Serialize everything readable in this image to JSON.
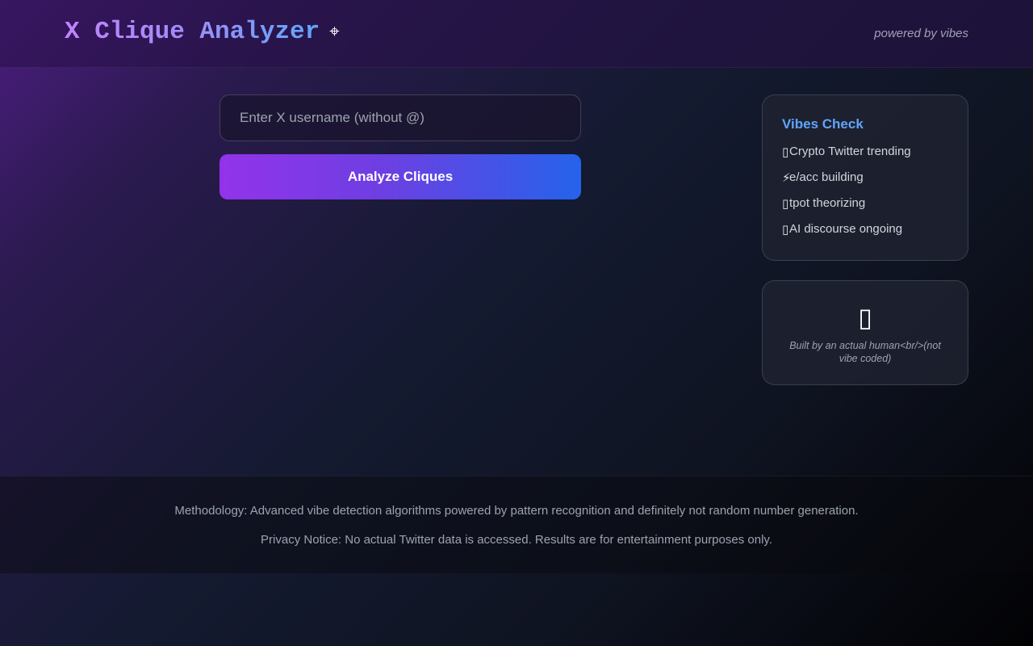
{
  "header": {
    "title": "X Clique Analyzer",
    "title_icon": "telescope-icon",
    "title_emoji": "⌖",
    "tagline": "powered by vibes"
  },
  "search": {
    "placeholder": "Enter X username (without @)",
    "value": ""
  },
  "analyze_button": {
    "label": "Analyze Cliques"
  },
  "vibes_check": {
    "title": "Vibes Check",
    "items": [
      {
        "icon": "chart-icon",
        "glyph": "▯",
        "label": "Crypto Twitter trending"
      },
      {
        "icon": "lightning-icon",
        "glyph": "⚡",
        "label": "e/acc building"
      },
      {
        "icon": "thought-icon",
        "glyph": "▯",
        "label": "tpot theorizing"
      },
      {
        "icon": "robot-icon",
        "glyph": "▯",
        "label": "AI discourse ongoing"
      }
    ]
  },
  "credit_card": {
    "icon": "human-icon",
    "glyph": "▯",
    "text": "Built by an actual human<br/>(not vibe coded)"
  },
  "footer": {
    "methodology": "Methodology: Advanced vibe detection algorithms powered by pattern recognition and definitely not random number generation.",
    "privacy": "Privacy Notice: No actual Twitter data is accessed. Results are for entertainment purposes only."
  },
  "colors": {
    "accent_purple": "#9333ea",
    "accent_blue": "#2563eb",
    "vibes_title": "#60a5fa",
    "background_dark": "#0f1422"
  }
}
